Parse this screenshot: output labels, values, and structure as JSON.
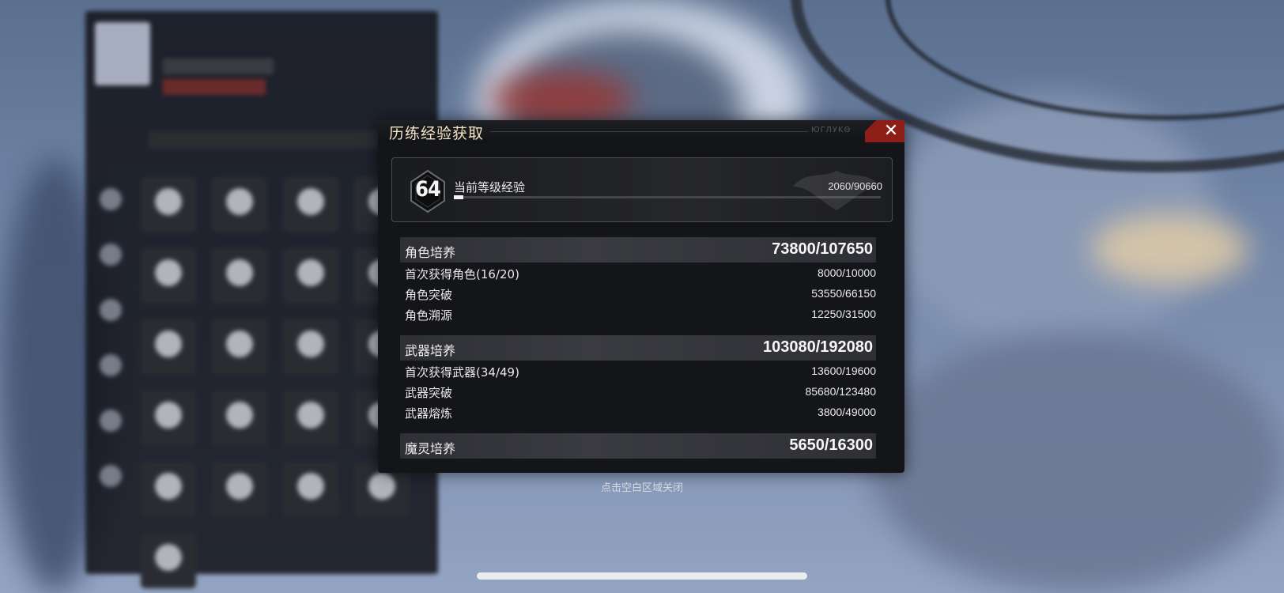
{
  "dialog": {
    "title": "历练经验获取",
    "deco_text": "ЮΓЛУΚΘ",
    "close_icon": "close-icon"
  },
  "level": {
    "number": "64",
    "label": "当前等级经验",
    "current": 2060,
    "max": 90660,
    "value_text": "2060/90660"
  },
  "sections": [
    {
      "label": "角色培养",
      "value": "73800/107650",
      "rows": [
        {
          "label": "首次获得角色(16/20)",
          "value": "8000/10000"
        },
        {
          "label": "角色突破",
          "value": "53550/66150"
        },
        {
          "label": "角色溯源",
          "value": "12250/31500"
        }
      ]
    },
    {
      "label": "武器培养",
      "value": "103080/192080",
      "rows": [
        {
          "label": "首次获得武器(34/49)",
          "value": "13600/19600"
        },
        {
          "label": "武器突破",
          "value": "85680/123480"
        },
        {
          "label": "武器熔炼",
          "value": "3800/49000"
        }
      ]
    },
    {
      "label": "魔灵培养",
      "value": "5650/16300",
      "rows": []
    }
  ],
  "hint": "点击空白区域关闭"
}
